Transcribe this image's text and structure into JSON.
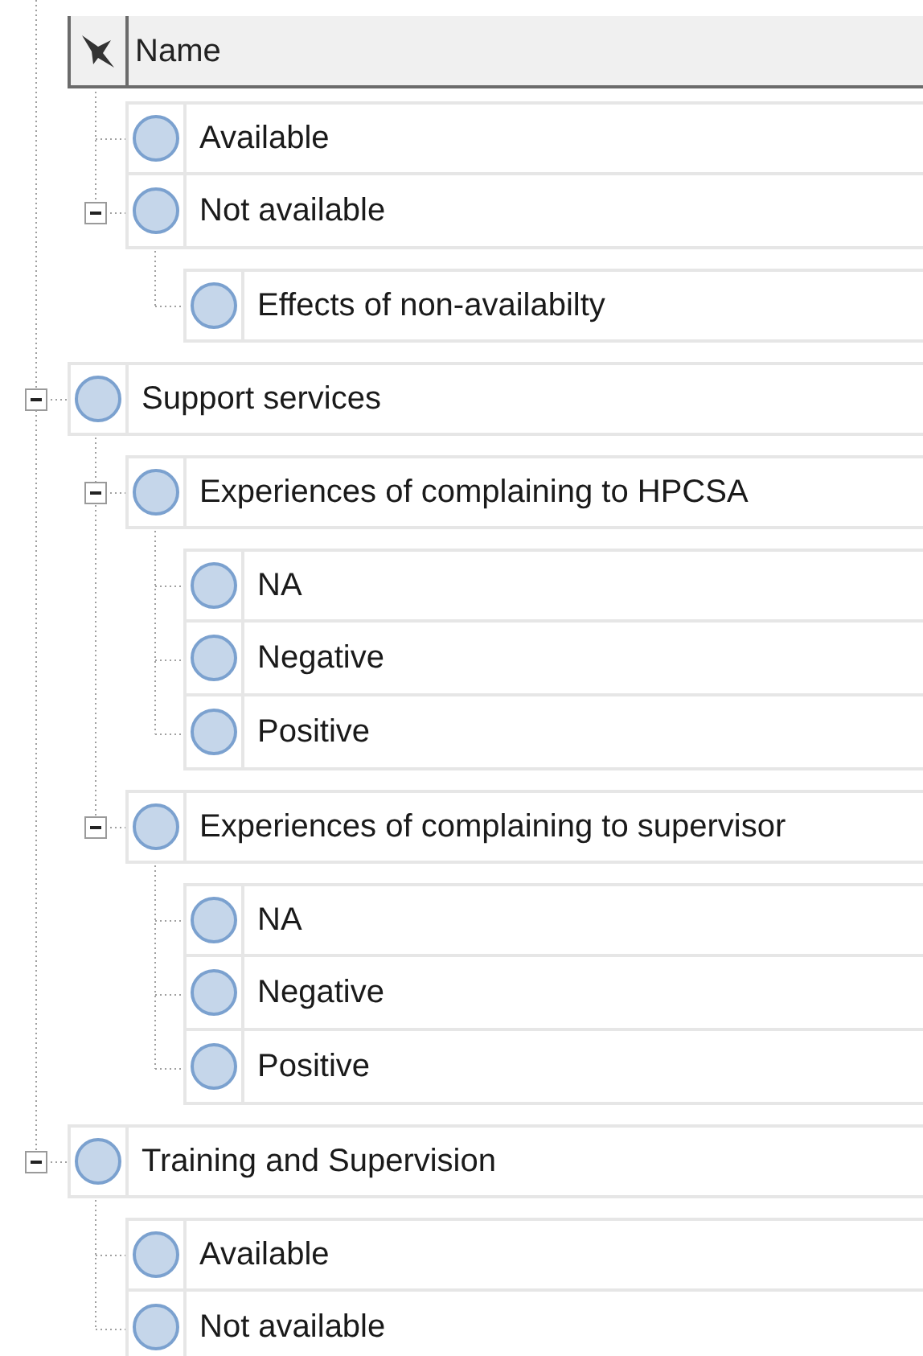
{
  "header": {
    "label": "Name"
  },
  "tree": {
    "continued_children": [
      {
        "label": "Available"
      },
      {
        "label": "Not available",
        "expanded": true,
        "children": [
          {
            "label": "Effects of non-availabilty"
          }
        ]
      }
    ],
    "items": [
      {
        "label": "Support services",
        "expanded": true,
        "children": [
          {
            "label": "Experiences of complaining to HPCSA",
            "expanded": true,
            "children": [
              {
                "label": "NA"
              },
              {
                "label": "Negative"
              },
              {
                "label": "Positive"
              }
            ]
          },
          {
            "label": "Experiences of complaining to supervisor",
            "expanded": true,
            "children": [
              {
                "label": "NA"
              },
              {
                "label": "Negative"
              },
              {
                "label": "Positive"
              }
            ]
          }
        ]
      },
      {
        "label": "Training and Supervision",
        "expanded": true,
        "children": [
          {
            "label": "Available"
          },
          {
            "label": "Not available"
          }
        ]
      }
    ]
  }
}
